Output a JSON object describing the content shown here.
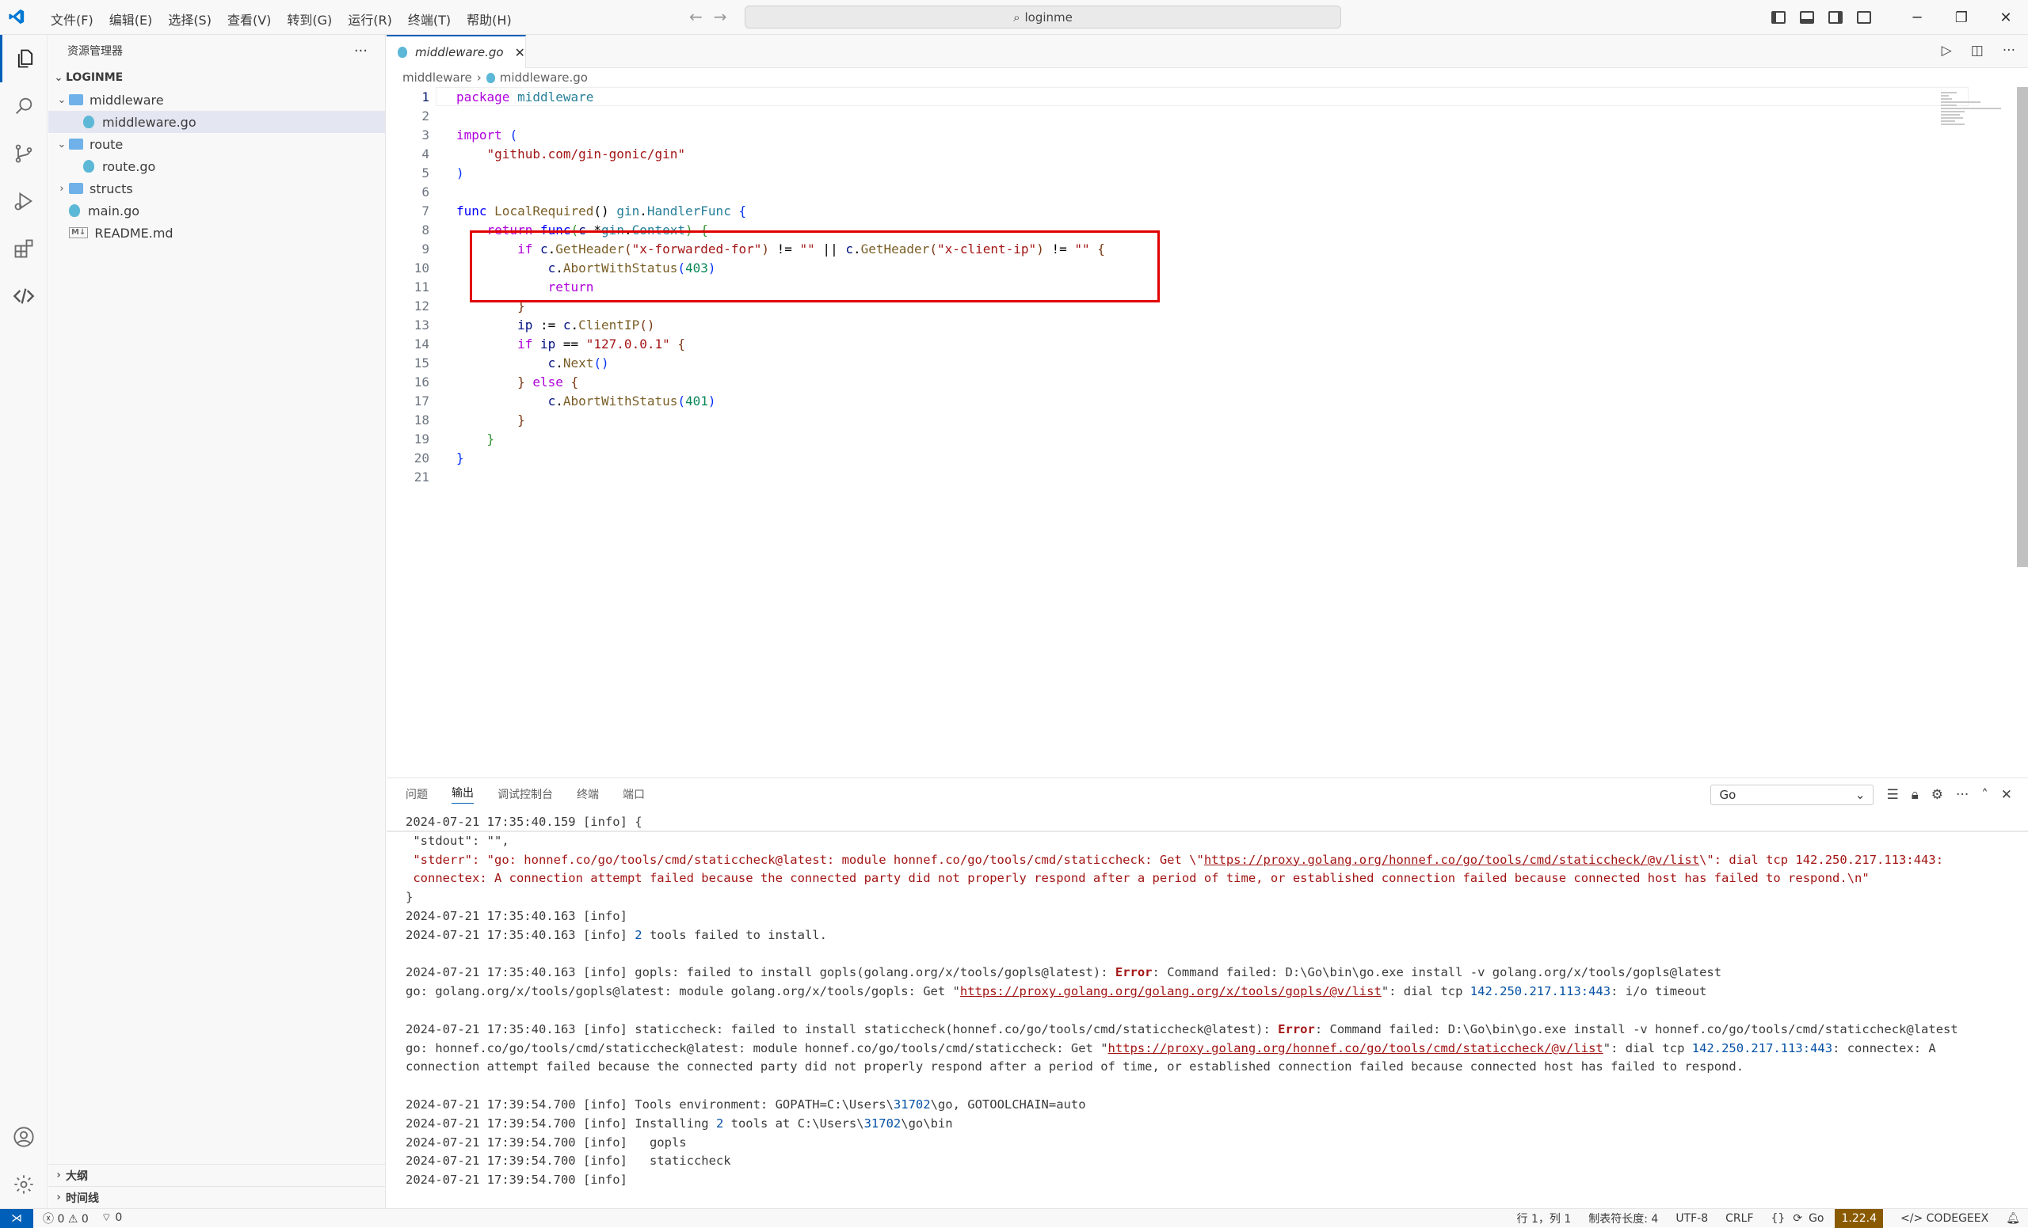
{
  "menu": [
    "文件(F)",
    "编辑(E)",
    "选择(S)",
    "查看(V)",
    "转到(G)",
    "运行(R)",
    "终端(T)",
    "帮助(H)"
  ],
  "search": {
    "text": "loginme"
  },
  "window_controls": {
    "minimize": "─",
    "restore": "❐",
    "close": "✕"
  },
  "sidebar": {
    "title": "资源管理器",
    "more": "···",
    "project": "LOGINME",
    "tree": [
      {
        "name": "middleware",
        "type": "folder",
        "level": 0,
        "open": true
      },
      {
        "name": "middleware.go",
        "type": "go",
        "level": 1,
        "selected": true
      },
      {
        "name": "route",
        "type": "folder",
        "level": 0,
        "open": true
      },
      {
        "name": "route.go",
        "type": "go",
        "level": 1
      },
      {
        "name": "structs",
        "type": "folder",
        "level": 0,
        "open": false
      },
      {
        "name": "main.go",
        "type": "go",
        "level": 0
      },
      {
        "name": "README.md",
        "type": "md",
        "level": 0
      }
    ],
    "outline": "大纲",
    "timeline": "时间线"
  },
  "editor": {
    "tab": "middleware.go",
    "breadcrumb": [
      "middleware",
      "middleware.go"
    ],
    "current_line": 1
  },
  "code_lines": [
    [
      [
        "package ",
        "kw"
      ],
      [
        "middleware",
        "ty"
      ]
    ],
    [],
    [
      [
        "import ",
        "kw"
      ],
      [
        "(",
        "br1"
      ]
    ],
    [
      [
        "    "
      ],
      [
        "\"github.com/gin-gonic/gin\"",
        "str"
      ]
    ],
    [
      [
        ")",
        "br1"
      ]
    ],
    [],
    [
      [
        "func ",
        "kw2"
      ],
      [
        "LocalRequired",
        "fn"
      ],
      [
        "() ",
        "plain"
      ],
      [
        "gin",
        "ty"
      ],
      [
        ".",
        "plain"
      ],
      [
        "HandlerFunc",
        "ty"
      ],
      [
        " {",
        "br1"
      ]
    ],
    [
      [
        "    "
      ],
      [
        "return ",
        "kw"
      ],
      [
        "func",
        "kw2"
      ],
      [
        "(",
        "br2"
      ],
      [
        "c ",
        "id"
      ],
      [
        "*",
        "plain"
      ],
      [
        "gin",
        "ty"
      ],
      [
        ".",
        "plain"
      ],
      [
        "Context",
        "ty"
      ],
      [
        ")",
        "br2"
      ],
      [
        " {",
        "br2"
      ]
    ],
    [
      [
        "        "
      ],
      [
        "if ",
        "kw"
      ],
      [
        "c",
        "id"
      ],
      [
        ".",
        "plain"
      ],
      [
        "GetHeader",
        "fn"
      ],
      [
        "(",
        "br3"
      ],
      [
        "\"x-forwarded-for\"",
        "str"
      ],
      [
        ")",
        "br3"
      ],
      [
        " != ",
        "plain"
      ],
      [
        "\"\"",
        "str"
      ],
      [
        " || ",
        "plain"
      ],
      [
        "c",
        "id"
      ],
      [
        ".",
        "plain"
      ],
      [
        "GetHeader",
        "fn"
      ],
      [
        "(",
        "br3"
      ],
      [
        "\"x-client-ip\"",
        "str"
      ],
      [
        ")",
        "br3"
      ],
      [
        " != ",
        "plain"
      ],
      [
        "\"\"",
        "str"
      ],
      [
        " {",
        "br3"
      ]
    ],
    [
      [
        "            "
      ],
      [
        "c",
        "id"
      ],
      [
        ".",
        "plain"
      ],
      [
        "AbortWithStatus",
        "fn"
      ],
      [
        "(",
        "br1"
      ],
      [
        "403",
        "num"
      ],
      [
        ")",
        "br1"
      ]
    ],
    [
      [
        "            "
      ],
      [
        "return",
        "kw"
      ]
    ],
    [
      [
        "        "
      ],
      [
        "}",
        "br3"
      ]
    ],
    [
      [
        "        "
      ],
      [
        "ip",
        "id"
      ],
      [
        " := ",
        "plain"
      ],
      [
        "c",
        "id"
      ],
      [
        ".",
        "plain"
      ],
      [
        "ClientIP",
        "fn"
      ],
      [
        "()",
        "br3"
      ]
    ],
    [
      [
        "        "
      ],
      [
        "if ",
        "kw"
      ],
      [
        "ip",
        "id"
      ],
      [
        " == ",
        "plain"
      ],
      [
        "\"127.0.0.1\"",
        "str"
      ],
      [
        " {",
        "br3"
      ]
    ],
    [
      [
        "            "
      ],
      [
        "c",
        "id"
      ],
      [
        ".",
        "plain"
      ],
      [
        "Next",
        "fn"
      ],
      [
        "()",
        "br1"
      ]
    ],
    [
      [
        "        "
      ],
      [
        "} ",
        "br3"
      ],
      [
        "else ",
        "kw"
      ],
      [
        "{",
        "br3"
      ]
    ],
    [
      [
        "            "
      ],
      [
        "c",
        "id"
      ],
      [
        ".",
        "plain"
      ],
      [
        "AbortWithStatus",
        "fn"
      ],
      [
        "(",
        "br1"
      ],
      [
        "401",
        "num"
      ],
      [
        ")",
        "br1"
      ]
    ],
    [
      [
        "        "
      ],
      [
        "}",
        "br3"
      ]
    ],
    [
      [
        "    "
      ],
      [
        "}",
        "br2"
      ]
    ],
    [
      [
        "}",
        "br1"
      ]
    ],
    []
  ],
  "panel": {
    "tabs": [
      "问题",
      "输出",
      "调试控制台",
      "终端",
      "端口"
    ],
    "active_tab": "输出",
    "channel": "Go",
    "output": [
      [
        [
          "2024-07-21 17:35:40.159 [info] {"
        ]
      ],
      [
        [
          " \"stdout\": \"\","
        ]
      ],
      [
        [
          " \"stderr\": \"go: honnef.co/go/tools/cmd/staticcheck@latest: module honnef.co/go/tools/cmd/staticcheck: Get \\\"",
          "err"
        ],
        [
          "https://proxy.golang.org/honnef.co/go/tools/cmd/staticcheck/@v/list",
          "link"
        ],
        [
          "\\\": dial tcp 142.250.217.113:443:",
          "err"
        ]
      ],
      [
        [
          " connectex: A connection attempt failed because the connected party did not properly respond after a period of time, or established connection failed because connected host has failed to respond.\\n\"",
          "err"
        ]
      ],
      [
        [
          "}"
        ]
      ],
      [
        [
          "2024-07-21 17:35:40.163 [info]"
        ]
      ],
      [
        [
          "2024-07-21 17:35:40.163 [info] "
        ],
        [
          "2",
          "ip"
        ],
        [
          " tools failed to install."
        ]
      ],
      [
        [
          ""
        ]
      ],
      [
        [
          "2024-07-21 17:35:40.163 [info] gopls: failed to install gopls(golang.org/x/tools/gopls@latest): "
        ],
        [
          "Error",
          "bold"
        ],
        [
          ": Command failed: D:\\Go\\bin\\go.exe install -v golang.org/x/tools/gopls@latest"
        ]
      ],
      [
        [
          "go: golang.org/x/tools/gopls@latest: module golang.org/x/tools/gopls: Get \""
        ],
        [
          "https://proxy.golang.org/golang.org/x/tools/gopls/@v/list",
          "link"
        ],
        [
          "\": dial tcp "
        ],
        [
          "142.250.217.113:443",
          "ip"
        ],
        [
          ": i/o timeout"
        ]
      ],
      [
        [
          ""
        ]
      ],
      [
        [
          "2024-07-21 17:35:40.163 [info] staticcheck: failed to install staticcheck(honnef.co/go/tools/cmd/staticcheck@latest): "
        ],
        [
          "Error",
          "bold"
        ],
        [
          ": Command failed: D:\\Go\\bin\\go.exe install -v honnef.co/go/tools/cmd/staticcheck@latest"
        ]
      ],
      [
        [
          "go: honnef.co/go/tools/cmd/staticcheck@latest: module honnef.co/go/tools/cmd/staticcheck: Get \""
        ],
        [
          "https://proxy.golang.org/honnef.co/go/tools/cmd/staticcheck/@v/list",
          "link"
        ],
        [
          "\": dial tcp "
        ],
        [
          "142.250.217.113:443",
          "ip"
        ],
        [
          ": connectex: A"
        ]
      ],
      [
        [
          "connection attempt failed because the connected party did not properly respond after a period of time, or established connection failed because connected host has failed to respond."
        ]
      ],
      [
        [
          ""
        ]
      ],
      [
        [
          "2024-07-21 17:39:54.700 [info] Tools environment: GOPATH=C:\\Users\\"
        ],
        [
          "31702",
          "ip"
        ],
        [
          "\\go, GOTOOLCHAIN=auto"
        ]
      ],
      [
        [
          "2024-07-21 17:39:54.700 [info] Installing "
        ],
        [
          "2",
          "ip"
        ],
        [
          " tools at C:\\Users\\"
        ],
        [
          "31702",
          "ip"
        ],
        [
          "\\go\\bin"
        ]
      ],
      [
        [
          "2024-07-21 17:39:54.700 [info]   gopls"
        ]
      ],
      [
        [
          "2024-07-21 17:39:54.700 [info]   staticcheck"
        ]
      ],
      [
        [
          "2024-07-21 17:39:54.700 [info]"
        ]
      ]
    ]
  },
  "status": {
    "errors": "0",
    "warnings": "0",
    "ports": "0",
    "position": "行 1，列 1",
    "indent": "制表符长度: 4",
    "encoding": "UTF-8",
    "eol": "CRLF",
    "braces": "{}",
    "language": "Go",
    "go_version": "1.22.4",
    "codegeex": "CODEGEEX"
  },
  "colors": {
    "accent": "#005fb8",
    "error_box": "#e00000",
    "go_version_bg": "#8a5a00"
  }
}
